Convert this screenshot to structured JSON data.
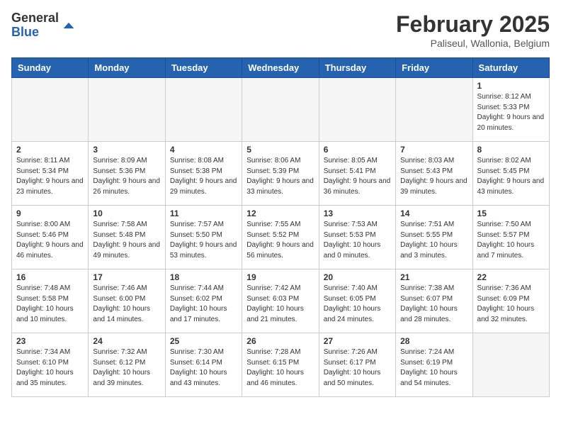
{
  "header": {
    "logo_general": "General",
    "logo_blue": "Blue",
    "month_title": "February 2025",
    "subtitle": "Paliseul, Wallonia, Belgium"
  },
  "weekdays": [
    "Sunday",
    "Monday",
    "Tuesday",
    "Wednesday",
    "Thursday",
    "Friday",
    "Saturday"
  ],
  "weeks": [
    [
      {
        "day": "",
        "info": ""
      },
      {
        "day": "",
        "info": ""
      },
      {
        "day": "",
        "info": ""
      },
      {
        "day": "",
        "info": ""
      },
      {
        "day": "",
        "info": ""
      },
      {
        "day": "",
        "info": ""
      },
      {
        "day": "1",
        "info": "Sunrise: 8:12 AM\nSunset: 5:33 PM\nDaylight: 9 hours and 20 minutes."
      }
    ],
    [
      {
        "day": "2",
        "info": "Sunrise: 8:11 AM\nSunset: 5:34 PM\nDaylight: 9 hours and 23 minutes."
      },
      {
        "day": "3",
        "info": "Sunrise: 8:09 AM\nSunset: 5:36 PM\nDaylight: 9 hours and 26 minutes."
      },
      {
        "day": "4",
        "info": "Sunrise: 8:08 AM\nSunset: 5:38 PM\nDaylight: 9 hours and 29 minutes."
      },
      {
        "day": "5",
        "info": "Sunrise: 8:06 AM\nSunset: 5:39 PM\nDaylight: 9 hours and 33 minutes."
      },
      {
        "day": "6",
        "info": "Sunrise: 8:05 AM\nSunset: 5:41 PM\nDaylight: 9 hours and 36 minutes."
      },
      {
        "day": "7",
        "info": "Sunrise: 8:03 AM\nSunset: 5:43 PM\nDaylight: 9 hours and 39 minutes."
      },
      {
        "day": "8",
        "info": "Sunrise: 8:02 AM\nSunset: 5:45 PM\nDaylight: 9 hours and 43 minutes."
      }
    ],
    [
      {
        "day": "9",
        "info": "Sunrise: 8:00 AM\nSunset: 5:46 PM\nDaylight: 9 hours and 46 minutes."
      },
      {
        "day": "10",
        "info": "Sunrise: 7:58 AM\nSunset: 5:48 PM\nDaylight: 9 hours and 49 minutes."
      },
      {
        "day": "11",
        "info": "Sunrise: 7:57 AM\nSunset: 5:50 PM\nDaylight: 9 hours and 53 minutes."
      },
      {
        "day": "12",
        "info": "Sunrise: 7:55 AM\nSunset: 5:52 PM\nDaylight: 9 hours and 56 minutes."
      },
      {
        "day": "13",
        "info": "Sunrise: 7:53 AM\nSunset: 5:53 PM\nDaylight: 10 hours and 0 minutes."
      },
      {
        "day": "14",
        "info": "Sunrise: 7:51 AM\nSunset: 5:55 PM\nDaylight: 10 hours and 3 minutes."
      },
      {
        "day": "15",
        "info": "Sunrise: 7:50 AM\nSunset: 5:57 PM\nDaylight: 10 hours and 7 minutes."
      }
    ],
    [
      {
        "day": "16",
        "info": "Sunrise: 7:48 AM\nSunset: 5:58 PM\nDaylight: 10 hours and 10 minutes."
      },
      {
        "day": "17",
        "info": "Sunrise: 7:46 AM\nSunset: 6:00 PM\nDaylight: 10 hours and 14 minutes."
      },
      {
        "day": "18",
        "info": "Sunrise: 7:44 AM\nSunset: 6:02 PM\nDaylight: 10 hours and 17 minutes."
      },
      {
        "day": "19",
        "info": "Sunrise: 7:42 AM\nSunset: 6:03 PM\nDaylight: 10 hours and 21 minutes."
      },
      {
        "day": "20",
        "info": "Sunrise: 7:40 AM\nSunset: 6:05 PM\nDaylight: 10 hours and 24 minutes."
      },
      {
        "day": "21",
        "info": "Sunrise: 7:38 AM\nSunset: 6:07 PM\nDaylight: 10 hours and 28 minutes."
      },
      {
        "day": "22",
        "info": "Sunrise: 7:36 AM\nSunset: 6:09 PM\nDaylight: 10 hours and 32 minutes."
      }
    ],
    [
      {
        "day": "23",
        "info": "Sunrise: 7:34 AM\nSunset: 6:10 PM\nDaylight: 10 hours and 35 minutes."
      },
      {
        "day": "24",
        "info": "Sunrise: 7:32 AM\nSunset: 6:12 PM\nDaylight: 10 hours and 39 minutes."
      },
      {
        "day": "25",
        "info": "Sunrise: 7:30 AM\nSunset: 6:14 PM\nDaylight: 10 hours and 43 minutes."
      },
      {
        "day": "26",
        "info": "Sunrise: 7:28 AM\nSunset: 6:15 PM\nDaylight: 10 hours and 46 minutes."
      },
      {
        "day": "27",
        "info": "Sunrise: 7:26 AM\nSunset: 6:17 PM\nDaylight: 10 hours and 50 minutes."
      },
      {
        "day": "28",
        "info": "Sunrise: 7:24 AM\nSunset: 6:19 PM\nDaylight: 10 hours and 54 minutes."
      },
      {
        "day": "",
        "info": ""
      }
    ]
  ]
}
